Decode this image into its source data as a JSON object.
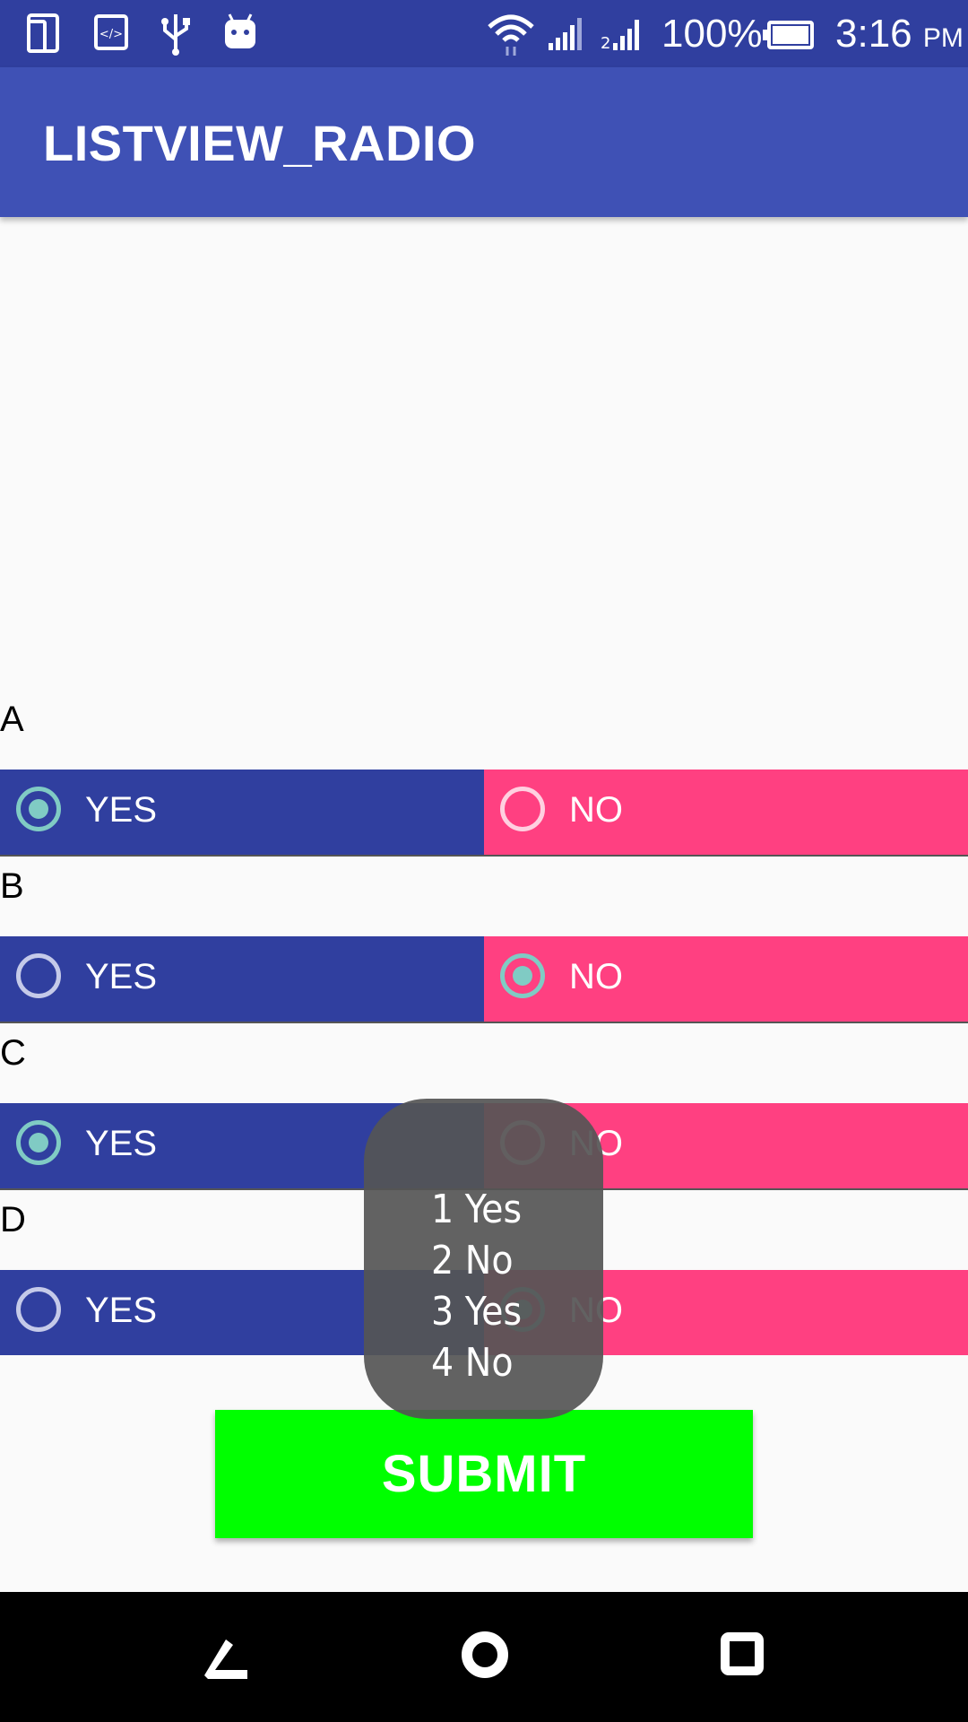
{
  "status_bar": {
    "battery": "100%",
    "time": "3:16",
    "ampm": "PM"
  },
  "app": {
    "title": "LISTVIEW_RADIO"
  },
  "questions": [
    {
      "label": "A",
      "yes": "YES",
      "no": "NO",
      "selected": "yes"
    },
    {
      "label": "B",
      "yes": "YES",
      "no": "NO",
      "selected": "no"
    },
    {
      "label": "C",
      "yes": "YES",
      "no": "NO",
      "selected": "yes"
    },
    {
      "label": "D",
      "yes": "YES",
      "no": "NO",
      "selected": "no"
    }
  ],
  "submit": {
    "label": "SUBMIT"
  },
  "toast": {
    "lines": [
      "1 Yes",
      "2 No",
      "3 Yes",
      "4 No"
    ]
  },
  "colors": {
    "status_bar": "#303f9f",
    "app_bar": "#3f51b5",
    "yes_bg": "#303f9f",
    "no_bg": "#ff4081",
    "radio_checked": "#80cbc4",
    "submit_bg": "#00ff00"
  },
  "icons": {
    "status_left": [
      "screen-mirror-icon",
      "developer-code-icon",
      "usb-icon",
      "android-debug-icon"
    ],
    "status_right": [
      "wifi-icon",
      "signal-icon",
      "signal-2-icon",
      "battery-icon"
    ],
    "nav": [
      "back-icon",
      "home-icon",
      "recents-icon"
    ]
  }
}
